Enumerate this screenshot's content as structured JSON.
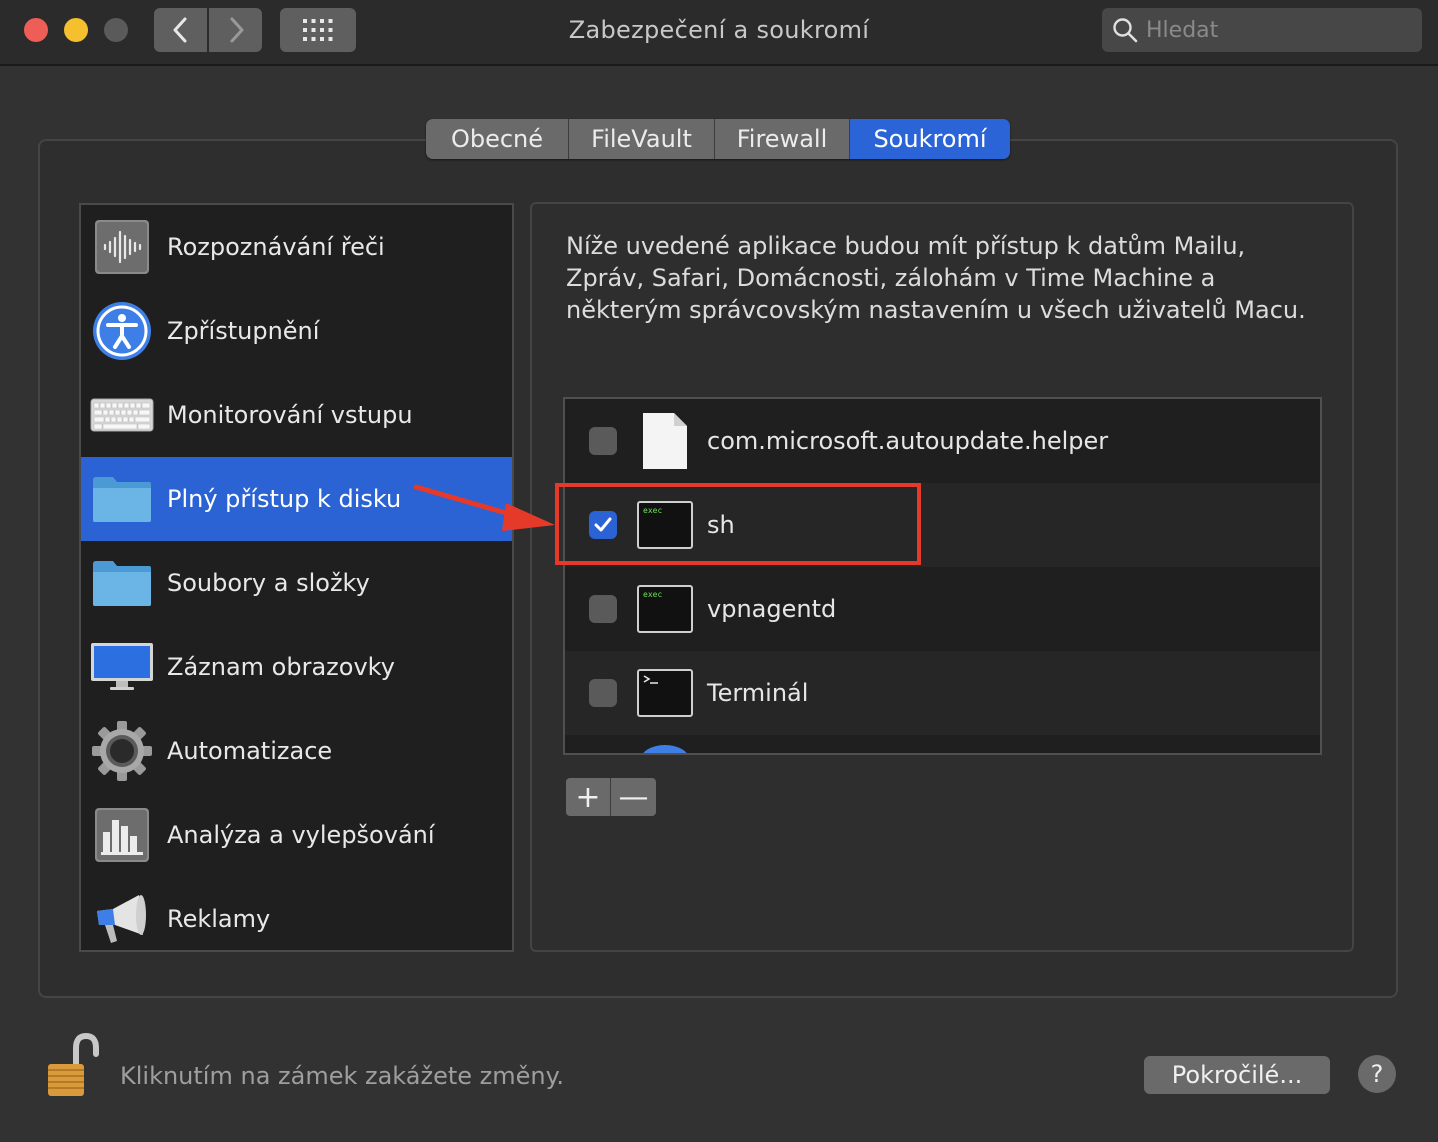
{
  "window": {
    "title": "Zabezpečení a soukromí"
  },
  "search": {
    "placeholder": "Hledat"
  },
  "tabs": [
    {
      "label": "Obecné",
      "width": 143
    },
    {
      "label": "FileVault",
      "width": 146
    },
    {
      "label": "Firewall",
      "width": 135
    },
    {
      "label": "Soukromí",
      "width": 160,
      "active": true
    }
  ],
  "sidebar": {
    "items": [
      {
        "label": "Rozpoznávání řeči",
        "icon": "speech-recognition-icon"
      },
      {
        "label": "Zpřístupnění",
        "icon": "accessibility-icon"
      },
      {
        "label": "Monitorování vstupu",
        "icon": "keyboard-icon"
      },
      {
        "label": "Plný přístup k disku",
        "icon": "folder-icon",
        "selected": true
      },
      {
        "label": "Soubory a složky",
        "icon": "folder-icon"
      },
      {
        "label": "Záznam obrazovky",
        "icon": "display-icon"
      },
      {
        "label": "Automatizace",
        "icon": "gear-icon"
      },
      {
        "label": "Analýza a vylepšování",
        "icon": "analytics-icon"
      },
      {
        "label": "Reklamy",
        "icon": "megaphone-icon"
      }
    ]
  },
  "main": {
    "description": "Níže uvedené aplikace budou mít přístup k datům Mailu, Zpráv, Safari, Domácnosti, zálohám v Time Machine a některým správcovským nastavením u všech uživatelů Macu.",
    "apps": [
      {
        "label": "com.microsoft.autoupdate.helper",
        "icon": "document-icon",
        "checked": false
      },
      {
        "label": "sh",
        "icon": "exec-icon",
        "checked": true
      },
      {
        "label": "vpnagentd",
        "icon": "exec-icon",
        "checked": false
      },
      {
        "label": "Terminál",
        "icon": "terminal-icon",
        "checked": false
      }
    ],
    "exec_badge": "exec",
    "add_label": "+",
    "remove_label": "—"
  },
  "footer": {
    "lock_text": "Kliknutím na zámek zakážete změny.",
    "advanced_label": "Pokročilé...",
    "help_label": "?"
  },
  "colors": {
    "accent": "#2b62d4",
    "annotation": "#e53a2a"
  }
}
